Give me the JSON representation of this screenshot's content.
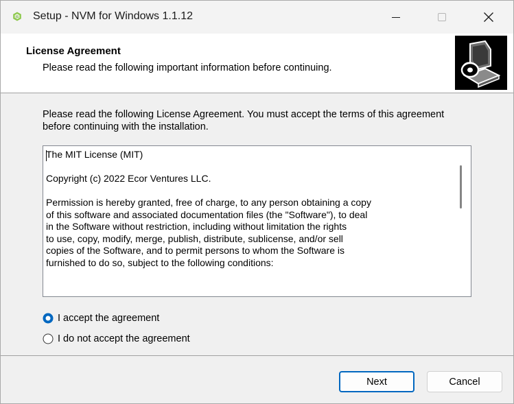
{
  "window": {
    "title": "Setup - NVM for Windows 1.1.12",
    "controls": {
      "minimize": "minimize-icon",
      "maximize": "maximize-icon",
      "close": "close-icon"
    },
    "app_icon": "nodejs-hexagon-icon"
  },
  "header": {
    "title": "License Agreement",
    "subtitle": "Please read the following important information before continuing.",
    "logo_icon": "computer-installer-icon"
  },
  "content": {
    "intro": "Please read the following License Agreement. You must accept the terms of this agreement before continuing with the installation.",
    "license_lines": [
      "The MIT License (MIT)",
      "",
      "Copyright (c) 2022 Ecor Ventures LLC.",
      "",
      "Permission is hereby granted, free of charge, to any person obtaining a copy",
      "of this software and associated documentation files (the \"Software\"), to deal",
      "in the Software without restriction, including without limitation the rights",
      "to use, copy, modify, merge, publish, distribute, sublicense, and/or sell",
      "copies of the Software, and to permit persons to whom the Software is",
      "furnished to do so, subject to the following conditions:"
    ],
    "options": [
      {
        "label": "I accept the agreement",
        "selected": true
      },
      {
        "label": "I do not accept the agreement",
        "selected": false
      }
    ]
  },
  "buttons": {
    "next": "Next",
    "cancel": "Cancel"
  },
  "colors": {
    "accent": "#0067c0",
    "window_bg": "#f0f0f0",
    "header_bg": "#ffffff",
    "node_green": "#8cc84b"
  }
}
